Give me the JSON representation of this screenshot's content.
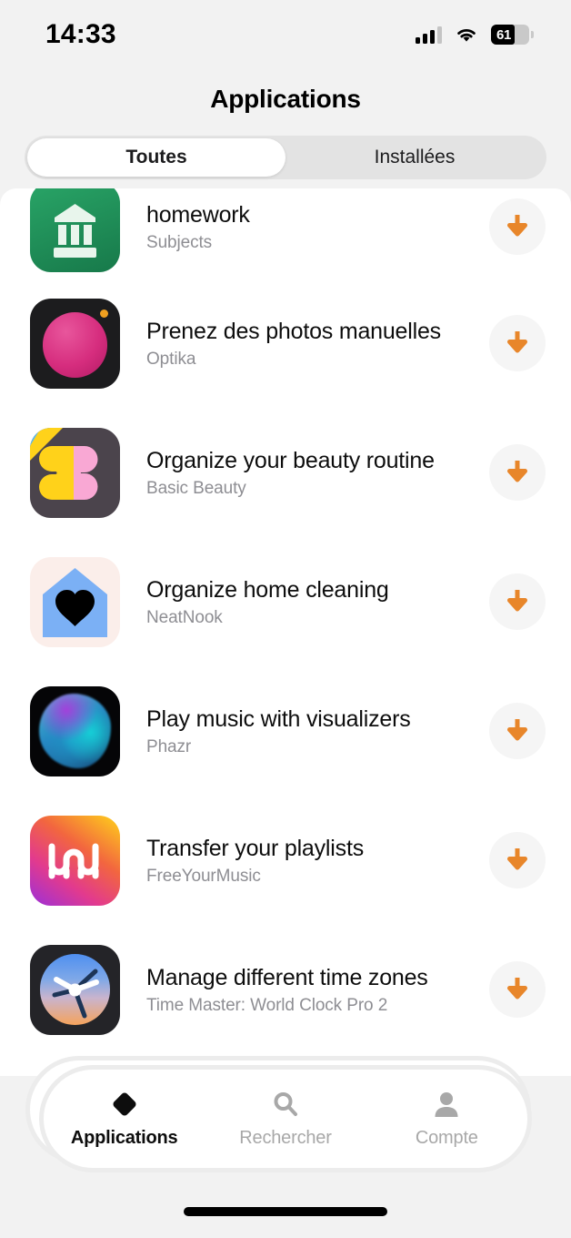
{
  "status_bar": {
    "time": "14:33",
    "signal_icon": "cellular-signal-icon",
    "wifi_icon": "wifi-icon",
    "battery_level": "61",
    "battery_icon": "battery-icon"
  },
  "header": {
    "title": "Applications"
  },
  "segmented_control": {
    "options": [
      {
        "label": "Toutes",
        "selected": true
      },
      {
        "label": "Installées",
        "selected": false
      }
    ]
  },
  "colors": {
    "page_background": "#f2f2f2",
    "content_background": "#ffffff",
    "accent_download": "#e8862a",
    "title_text": "#0d0d0d",
    "subtitle_text": "#8e8e93",
    "segment_track": "#e3e3e3",
    "tab_inactive": "#a8a8a8"
  },
  "app_list": [
    {
      "title": "homework",
      "developer": "Subjects",
      "icon_name": "subjects-app-icon",
      "action_icon": "download-arrow-icon"
    },
    {
      "title": "Prenez des photos manuelles",
      "developer": "Optika",
      "icon_name": "optika-camera-app-icon",
      "action_icon": "download-arrow-icon"
    },
    {
      "title": "Organize your beauty routine",
      "developer": "Basic Beauty",
      "icon_name": "basic-beauty-app-icon",
      "action_icon": "download-arrow-icon"
    },
    {
      "title": "Organize home cleaning",
      "developer": "NeatNook",
      "icon_name": "neatnook-app-icon",
      "action_icon": "download-arrow-icon"
    },
    {
      "title": "Play music with visualizers",
      "developer": "Phazr",
      "icon_name": "phazr-app-icon",
      "action_icon": "download-arrow-icon"
    },
    {
      "title": "Transfer your playlists",
      "developer": "FreeYourMusic",
      "icon_name": "freeyourmusic-app-icon",
      "action_icon": "download-arrow-icon"
    },
    {
      "title": "Manage different time zones",
      "developer": "Time Master: World Clock Pro 2",
      "icon_name": "time-master-app-icon",
      "action_icon": "download-arrow-icon"
    }
  ],
  "tab_bar": {
    "items": [
      {
        "label": "Applications",
        "icon": "diamond-icon",
        "active": true
      },
      {
        "label": "Rechercher",
        "icon": "search-icon",
        "active": false
      },
      {
        "label": "Compte",
        "icon": "person-icon",
        "active": false
      }
    ]
  }
}
